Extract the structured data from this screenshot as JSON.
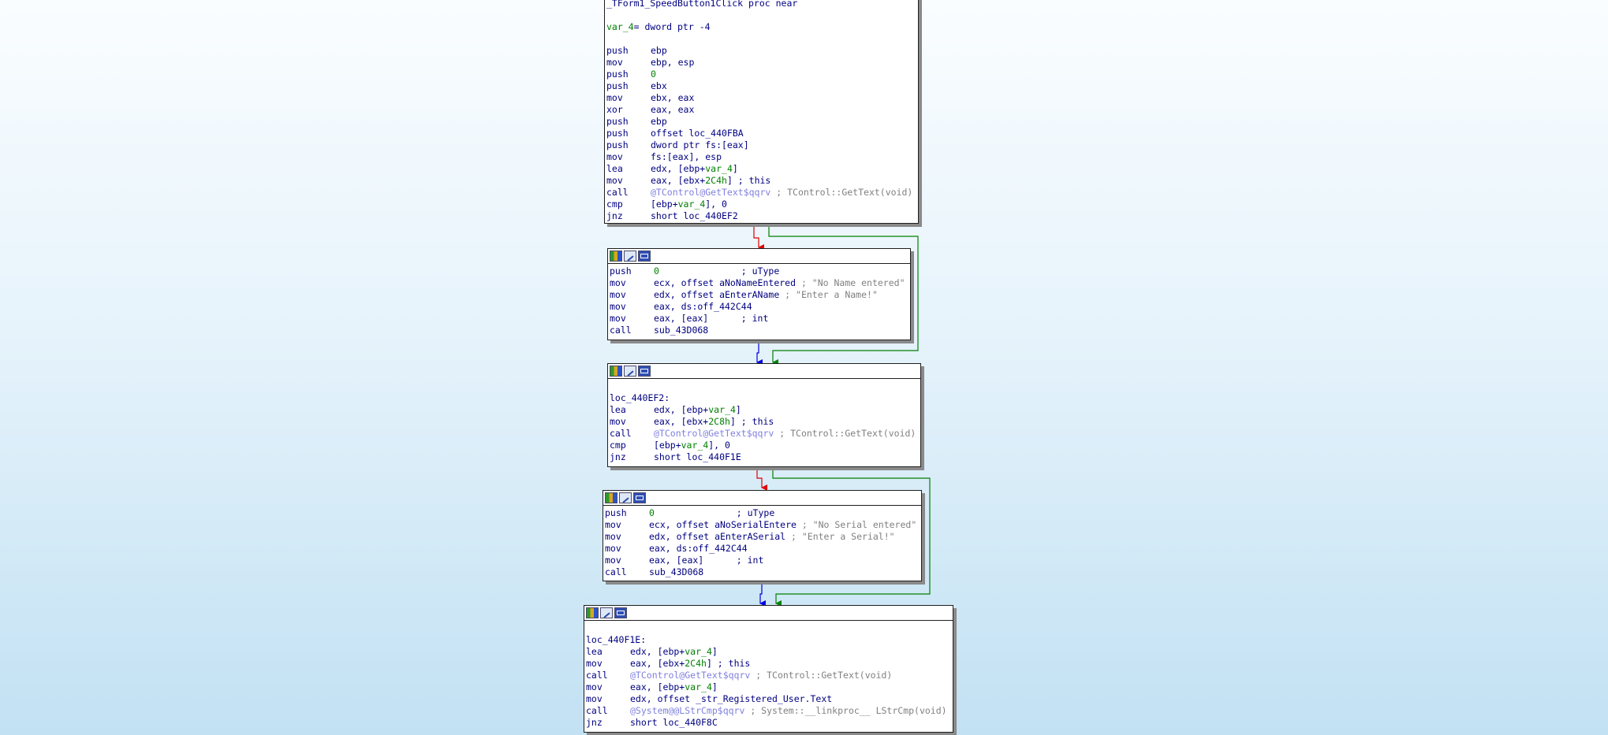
{
  "palette": {
    "background_top": "#fafdff",
    "background_bottom": "#c2e1f3",
    "instruction": "#000080",
    "immediate": "#008000",
    "import_name": "#8080e0",
    "comment": "#808080",
    "edge_true": "#008000",
    "edge_false": "#e00000",
    "edge_unconditional": "#0000e0"
  },
  "node_toolbar_icons": [
    "colors-icon",
    "rename-icon",
    "group-icon"
  ],
  "nodes": [
    {
      "id": "proc-entry",
      "header": false,
      "lines": [
        [
          {
            "t": "_TForm1_SpeedButton1Click proc near",
            "c": "fn"
          }
        ],
        [],
        [
          {
            "t": "var_4",
            "c": "var"
          },
          {
            "t": "= dword ptr -4",
            "c": "op"
          }
        ],
        [],
        [
          {
            "t": "push",
            "c": "mn"
          },
          {
            "t": "ebp",
            "c": "op"
          }
        ],
        [
          {
            "t": "mov",
            "c": "mn"
          },
          {
            "t": "ebp, esp",
            "c": "op"
          }
        ],
        [
          {
            "t": "push",
            "c": "mn"
          },
          {
            "t": "0",
            "c": "num"
          }
        ],
        [
          {
            "t": "push",
            "c": "mn"
          },
          {
            "t": "ebx",
            "c": "op"
          }
        ],
        [
          {
            "t": "mov",
            "c": "mn"
          },
          {
            "t": "ebx, eax",
            "c": "op"
          }
        ],
        [
          {
            "t": "xor",
            "c": "mn"
          },
          {
            "t": "eax, eax",
            "c": "op"
          }
        ],
        [
          {
            "t": "push",
            "c": "mn"
          },
          {
            "t": "ebp",
            "c": "op"
          }
        ],
        [
          {
            "t": "push",
            "c": "mn"
          },
          {
            "t": "offset loc_440FBA",
            "c": "op"
          }
        ],
        [
          {
            "t": "push",
            "c": "mn"
          },
          {
            "t": "dword ptr fs:[eax]",
            "c": "op"
          }
        ],
        [
          {
            "t": "mov",
            "c": "mn"
          },
          {
            "t": "fs:[eax], esp",
            "c": "op"
          }
        ],
        [
          {
            "t": "lea",
            "c": "mn"
          },
          {
            "t": "edx, [ebp+",
            "c": "op"
          },
          {
            "t": "var_4",
            "c": "var"
          },
          {
            "t": "]",
            "c": "op"
          }
        ],
        [
          {
            "t": "mov",
            "c": "mn"
          },
          {
            "t": "eax, [ebx+",
            "c": "op"
          },
          {
            "t": "2C4h",
            "c": "num"
          },
          {
            "t": "] ; this",
            "c": "op"
          }
        ],
        [
          {
            "t": "call",
            "c": "mn"
          },
          {
            "t": "@TControl@GetText$qqrv",
            "c": "imp"
          },
          {
            "t": " ; TControl::GetText(void)",
            "c": "cmt"
          }
        ],
        [
          {
            "t": "cmp",
            "c": "mn"
          },
          {
            "t": "[ebp+",
            "c": "op"
          },
          {
            "t": "var_4",
            "c": "var"
          },
          {
            "t": "], 0",
            "c": "op"
          }
        ],
        [
          {
            "t": "jnz",
            "c": "mn"
          },
          {
            "t": "short loc_440EF2",
            "c": "op"
          }
        ]
      ]
    },
    {
      "id": "no-name-block",
      "header": true,
      "lines": [
        [
          {
            "t": "push",
            "c": "mn"
          },
          {
            "t": "0",
            "c": "num"
          },
          {
            "t": "               ; uType",
            "c": "op"
          }
        ],
        [
          {
            "t": "mov",
            "c": "mn"
          },
          {
            "t": "ecx, offset aNoNameEntered",
            "c": "op"
          },
          {
            "t": " ; \"No Name entered\"",
            "c": "cmt"
          }
        ],
        [
          {
            "t": "mov",
            "c": "mn"
          },
          {
            "t": "edx, offset aEnterAName",
            "c": "op"
          },
          {
            "t": " ; \"Enter a Name!\"",
            "c": "cmt"
          }
        ],
        [
          {
            "t": "mov",
            "c": "mn"
          },
          {
            "t": "eax, ds:off_442C44",
            "c": "op"
          }
        ],
        [
          {
            "t": "mov",
            "c": "mn"
          },
          {
            "t": "eax, [eax]      ; int",
            "c": "op"
          }
        ],
        [
          {
            "t": "call",
            "c": "mn"
          },
          {
            "t": "sub_43D068",
            "c": "op"
          }
        ]
      ]
    },
    {
      "id": "loc-440ef2-block",
      "header": true,
      "lines": [
        [],
        [
          {
            "t": "loc_440EF2:",
            "c": "lbl"
          }
        ],
        [
          {
            "t": "lea",
            "c": "mn"
          },
          {
            "t": "edx, [ebp+",
            "c": "op"
          },
          {
            "t": "var_4",
            "c": "var"
          },
          {
            "t": "]",
            "c": "op"
          }
        ],
        [
          {
            "t": "mov",
            "c": "mn"
          },
          {
            "t": "eax, [ebx+",
            "c": "op"
          },
          {
            "t": "2C8h",
            "c": "num"
          },
          {
            "t": "] ; this",
            "c": "op"
          }
        ],
        [
          {
            "t": "call",
            "c": "mn"
          },
          {
            "t": "@TControl@GetText$qqrv",
            "c": "imp"
          },
          {
            "t": " ; TControl::GetText(void)",
            "c": "cmt"
          }
        ],
        [
          {
            "t": "cmp",
            "c": "mn"
          },
          {
            "t": "[ebp+",
            "c": "op"
          },
          {
            "t": "var_4",
            "c": "var"
          },
          {
            "t": "], 0",
            "c": "op"
          }
        ],
        [
          {
            "t": "jnz",
            "c": "mn"
          },
          {
            "t": "short loc_440F1E",
            "c": "op"
          }
        ]
      ]
    },
    {
      "id": "no-serial-block",
      "header": true,
      "lines": [
        [
          {
            "t": "push",
            "c": "mn"
          },
          {
            "t": "0",
            "c": "num"
          },
          {
            "t": "               ; uType",
            "c": "op"
          }
        ],
        [
          {
            "t": "mov",
            "c": "mn"
          },
          {
            "t": "ecx, offset aNoSerialEntere",
            "c": "op"
          },
          {
            "t": " ; \"No Serial entered\"",
            "c": "cmt"
          }
        ],
        [
          {
            "t": "mov",
            "c": "mn"
          },
          {
            "t": "edx, offset aEnterASerial",
            "c": "op"
          },
          {
            "t": " ; \"Enter a Serial!\"",
            "c": "cmt"
          }
        ],
        [
          {
            "t": "mov",
            "c": "mn"
          },
          {
            "t": "eax, ds:off_442C44",
            "c": "op"
          }
        ],
        [
          {
            "t": "mov",
            "c": "mn"
          },
          {
            "t": "eax, [eax]      ; int",
            "c": "op"
          }
        ],
        [
          {
            "t": "call",
            "c": "mn"
          },
          {
            "t": "sub_43D068",
            "c": "op"
          }
        ]
      ]
    },
    {
      "id": "loc-440f1e-block",
      "header": true,
      "lines": [
        [],
        [
          {
            "t": "loc_440F1E:",
            "c": "lbl"
          }
        ],
        [
          {
            "t": "lea",
            "c": "mn"
          },
          {
            "t": "edx, [ebp+",
            "c": "op"
          },
          {
            "t": "var_4",
            "c": "var"
          },
          {
            "t": "]",
            "c": "op"
          }
        ],
        [
          {
            "t": "mov",
            "c": "mn"
          },
          {
            "t": "eax, [ebx+",
            "c": "op"
          },
          {
            "t": "2C4h",
            "c": "num"
          },
          {
            "t": "] ; this",
            "c": "op"
          }
        ],
        [
          {
            "t": "call",
            "c": "mn"
          },
          {
            "t": "@TControl@GetText$qqrv",
            "c": "imp"
          },
          {
            "t": " ; TControl::GetText(void)",
            "c": "cmt"
          }
        ],
        [
          {
            "t": "mov",
            "c": "mn"
          },
          {
            "t": "eax, [ebp+",
            "c": "op"
          },
          {
            "t": "var_4",
            "c": "var"
          },
          {
            "t": "]",
            "c": "op"
          }
        ],
        [
          {
            "t": "mov",
            "c": "mn"
          },
          {
            "t": "edx, offset _str_Registered_User.Text",
            "c": "op"
          }
        ],
        [
          {
            "t": "call",
            "c": "mn"
          },
          {
            "t": "@System@@LStrCmp$qqrv",
            "c": "imp"
          },
          {
            "t": " ; System::__linkproc__ LStrCmp(void)",
            "c": "cmt"
          }
        ],
        [
          {
            "t": "jnz",
            "c": "mn"
          },
          {
            "t": "short loc_440F8C",
            "c": "op"
          }
        ]
      ]
    }
  ]
}
